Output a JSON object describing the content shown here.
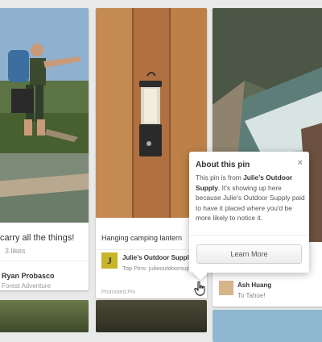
{
  "pins": {
    "left": {
      "description": "carry all the things!",
      "likes": "3 likes",
      "author": "Ryan Probasco",
      "board": "Forest Adventure"
    },
    "middle": {
      "title": "Hanging camping lantern",
      "logo_letter": "J",
      "supplier": "Julie's Outdoor Supply",
      "top_pins": "Top Pins: julieoutdoorsupply",
      "promoted_label": "Promoted Pin"
    },
    "right": {
      "name": "Ash Huang",
      "board": "To Tahoe!"
    }
  },
  "popover": {
    "title": "About this pin",
    "close": "×",
    "text_before": "This pin is from ",
    "text_bold": "Julie's Outdoor Supply",
    "text_after": ". It's showing up here because Julie's Outdoor Supply paid to have it placed where you'd be more likely to notice it.",
    "button_label": "Learn More"
  },
  "icons": [
    "promoted-pin-icon",
    "close-icon",
    "hand-cursor-icon"
  ]
}
